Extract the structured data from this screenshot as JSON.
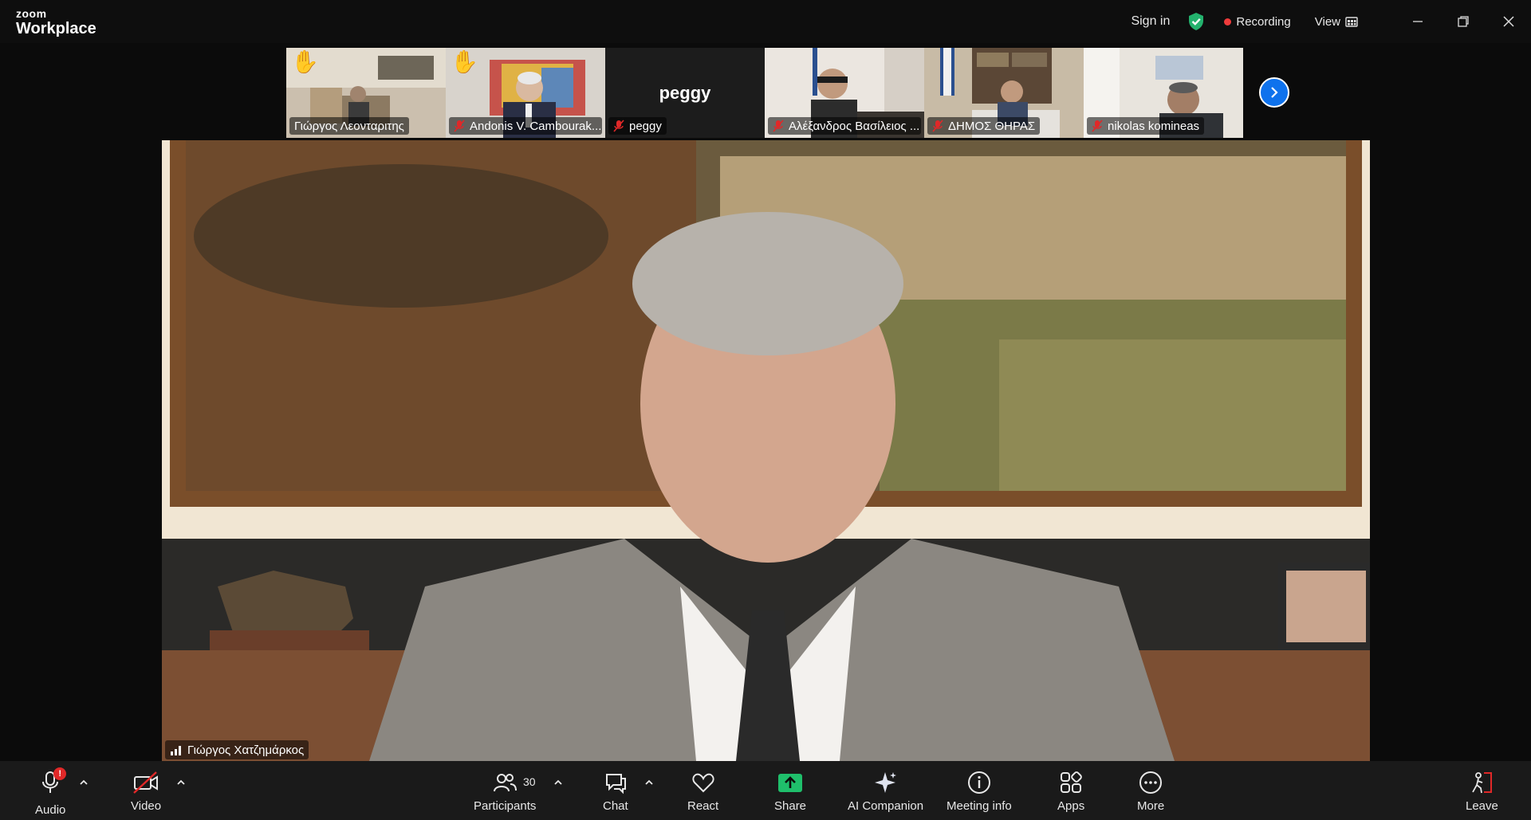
{
  "app": {
    "brand_top": "zoom",
    "brand_bottom": "Workplace"
  },
  "titlebar": {
    "signin": "Sign in",
    "recording": "Recording",
    "view": "View"
  },
  "colors": {
    "accent": "#0e72ed",
    "recording": "#ef3b3b",
    "shield": "#23b26d",
    "share": "#1fbf6b",
    "muted": "#e02828"
  },
  "thumbnails": [
    {
      "name": "Γιώργος Λεονταριτης",
      "hand_raised": true,
      "muted": false
    },
    {
      "name": "Andonis V. Cambourak...",
      "hand_raised": true,
      "muted": true
    },
    {
      "name": "peggy",
      "big_name": "peggy",
      "hand_raised": false,
      "muted": true
    },
    {
      "name": "Αλέξανδρος Βασίλειος ...",
      "hand_raised": false,
      "muted": true
    },
    {
      "name": "ΔΗΜΟΣ ΘΗΡΑΣ",
      "hand_raised": false,
      "muted": true
    },
    {
      "name": "nikolas komineas",
      "hand_raised": false,
      "muted": true
    }
  ],
  "main": {
    "speaker_name": "Γιώργος Χατζημάρκος"
  },
  "toolbar": {
    "audio": "Audio",
    "audio_badge": "!",
    "video": "Video",
    "participants": "Participants",
    "participants_count": "30",
    "chat": "Chat",
    "react": "React",
    "share": "Share",
    "ai_companion": "AI Companion",
    "meeting_info": "Meeting info",
    "apps": "Apps",
    "more": "More",
    "leave": "Leave"
  }
}
